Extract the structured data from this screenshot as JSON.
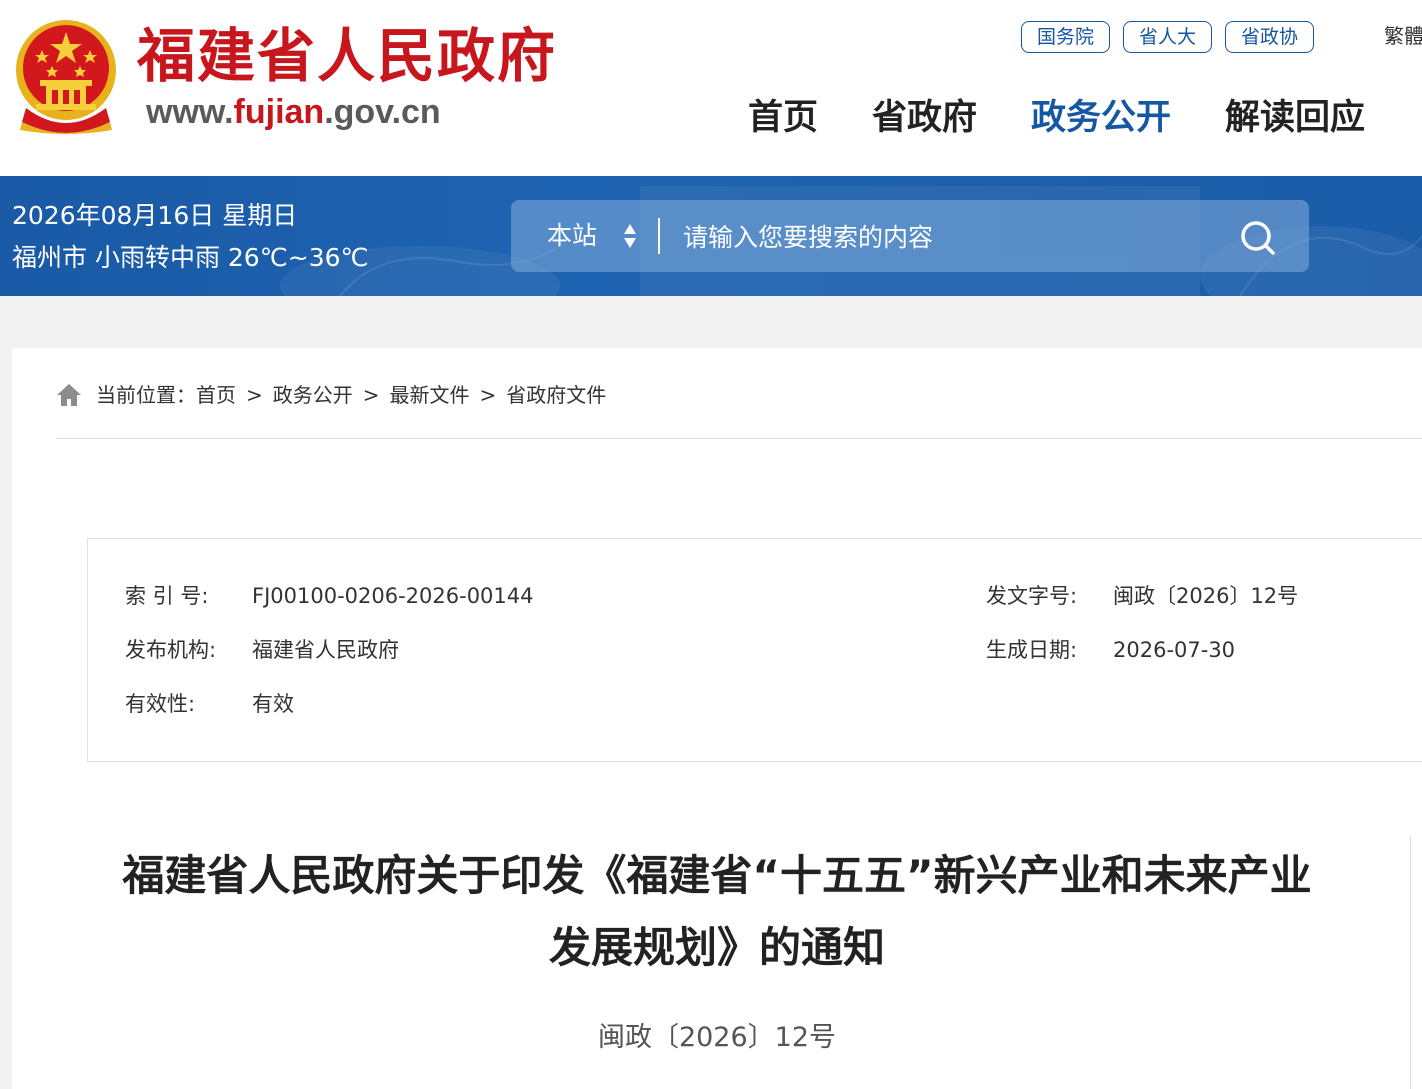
{
  "header": {
    "site_title": "福建省人民政府",
    "site_url_prefix": "www.",
    "site_url_domain": "fujian",
    "site_url_suffix": ".gov.cn",
    "top_links": [
      "国务院",
      "省人大",
      "省政协"
    ],
    "lang_switch": "繁體",
    "nav": [
      {
        "label": "首页",
        "active": false
      },
      {
        "label": "省政府",
        "active": false
      },
      {
        "label": "政务公开",
        "active": true
      },
      {
        "label": "解读回应",
        "active": false
      }
    ],
    "colors": {
      "brand_red": "#c8161d",
      "brand_blue": "#1657a3"
    }
  },
  "band": {
    "date": "2026年08月16日 星期日",
    "weather": "福州市 小雨转中雨 26℃~36℃",
    "search": {
      "scope": "本站",
      "placeholder": "请输入您要搜索的内容"
    }
  },
  "breadcrumb": {
    "prefix": "当前位置：",
    "items": [
      "首页",
      "政务公开",
      "最新文件",
      "省政府文件"
    ],
    "separator": ">"
  },
  "meta": {
    "index_no_label": "索 引 号:",
    "index_no": "FJ00100-0206-2026-00144",
    "doc_no_label": "发文字号:",
    "doc_no": "闽政〔2026〕12号",
    "publisher_label": "发布机构:",
    "publisher": "福建省人民政府",
    "created_label": "生成日期:",
    "created": "2026-07-30",
    "validity_label": "有效性:",
    "validity": "有效"
  },
  "document": {
    "title_line1": "福建省人民政府关于印发《福建省“十五五”新兴产业和未来产业",
    "title_line2": "发展规划》的通知",
    "number": "闽政〔2026〕12号"
  }
}
